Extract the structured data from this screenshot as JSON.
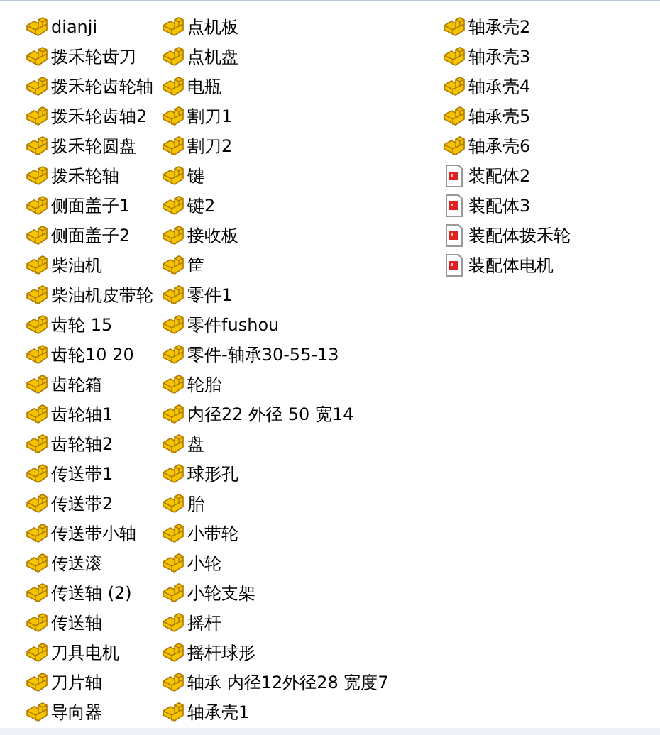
{
  "files": [
    {
      "name": "dianji",
      "kind": "part"
    },
    {
      "name": "拨禾轮齿刀",
      "kind": "part"
    },
    {
      "name": "拨禾轮齿轮轴",
      "kind": "part"
    },
    {
      "name": "拨禾轮齿轴2",
      "kind": "part"
    },
    {
      "name": "拨禾轮圆盘",
      "kind": "part"
    },
    {
      "name": "拨禾轮轴",
      "kind": "part"
    },
    {
      "name": "侧面盖子1",
      "kind": "part"
    },
    {
      "name": "侧面盖子2",
      "kind": "part"
    },
    {
      "name": "柴油机",
      "kind": "part"
    },
    {
      "name": "柴油机皮带轮",
      "kind": "part"
    },
    {
      "name": "齿轮 15",
      "kind": "part"
    },
    {
      "name": "齿轮10 20",
      "kind": "part"
    },
    {
      "name": "齿轮箱",
      "kind": "part"
    },
    {
      "name": "齿轮轴1",
      "kind": "part"
    },
    {
      "name": "齿轮轴2",
      "kind": "part"
    },
    {
      "name": "传送带1",
      "kind": "part"
    },
    {
      "name": "传送带2",
      "kind": "part"
    },
    {
      "name": "传送带小轴",
      "kind": "part"
    },
    {
      "name": "传送滚",
      "kind": "part"
    },
    {
      "name": "传送轴 (2)",
      "kind": "part"
    },
    {
      "name": "传送轴",
      "kind": "part"
    },
    {
      "name": "刀具电机",
      "kind": "part"
    },
    {
      "name": "刀片轴",
      "kind": "part"
    },
    {
      "name": "导向器",
      "kind": "part"
    },
    {
      "name": "点机板",
      "kind": "part"
    },
    {
      "name": "点机盘",
      "kind": "part"
    },
    {
      "name": "电瓶",
      "kind": "part"
    },
    {
      "name": "割刀1",
      "kind": "part"
    },
    {
      "name": "割刀2",
      "kind": "part"
    },
    {
      "name": "键",
      "kind": "part"
    },
    {
      "name": "键2",
      "kind": "part"
    },
    {
      "name": "接收板",
      "kind": "part"
    },
    {
      "name": "筐",
      "kind": "part"
    },
    {
      "name": "零件1",
      "kind": "part"
    },
    {
      "name": "零件fushou",
      "kind": "part"
    },
    {
      "name": "零件-轴承30-55-13",
      "kind": "part"
    },
    {
      "name": "轮胎",
      "kind": "part"
    },
    {
      "name": "内径22  外径 50  宽14",
      "kind": "part"
    },
    {
      "name": "盘",
      "kind": "part"
    },
    {
      "name": "球形孔",
      "kind": "part"
    },
    {
      "name": "胎",
      "kind": "part"
    },
    {
      "name": "小带轮",
      "kind": "part"
    },
    {
      "name": "小轮",
      "kind": "part"
    },
    {
      "name": "小轮支架",
      "kind": "part"
    },
    {
      "name": "摇杆",
      "kind": "part"
    },
    {
      "name": "摇杆球形",
      "kind": "part"
    },
    {
      "name": "轴承  内径12外径28  宽度7",
      "kind": "part"
    },
    {
      "name": "轴承壳1",
      "kind": "part"
    },
    {
      "name": "轴承壳2",
      "kind": "part"
    },
    {
      "name": "轴承壳3",
      "kind": "part"
    },
    {
      "name": "轴承壳4",
      "kind": "part"
    },
    {
      "name": "轴承壳5",
      "kind": "part"
    },
    {
      "name": "轴承壳6",
      "kind": "part"
    },
    {
      "name": "装配体2",
      "kind": "assembly"
    },
    {
      "name": "装配体3",
      "kind": "assembly"
    },
    {
      "name": "装配体拨禾轮",
      "kind": "assembly"
    },
    {
      "name": "装配体电机",
      "kind": "assembly"
    }
  ]
}
